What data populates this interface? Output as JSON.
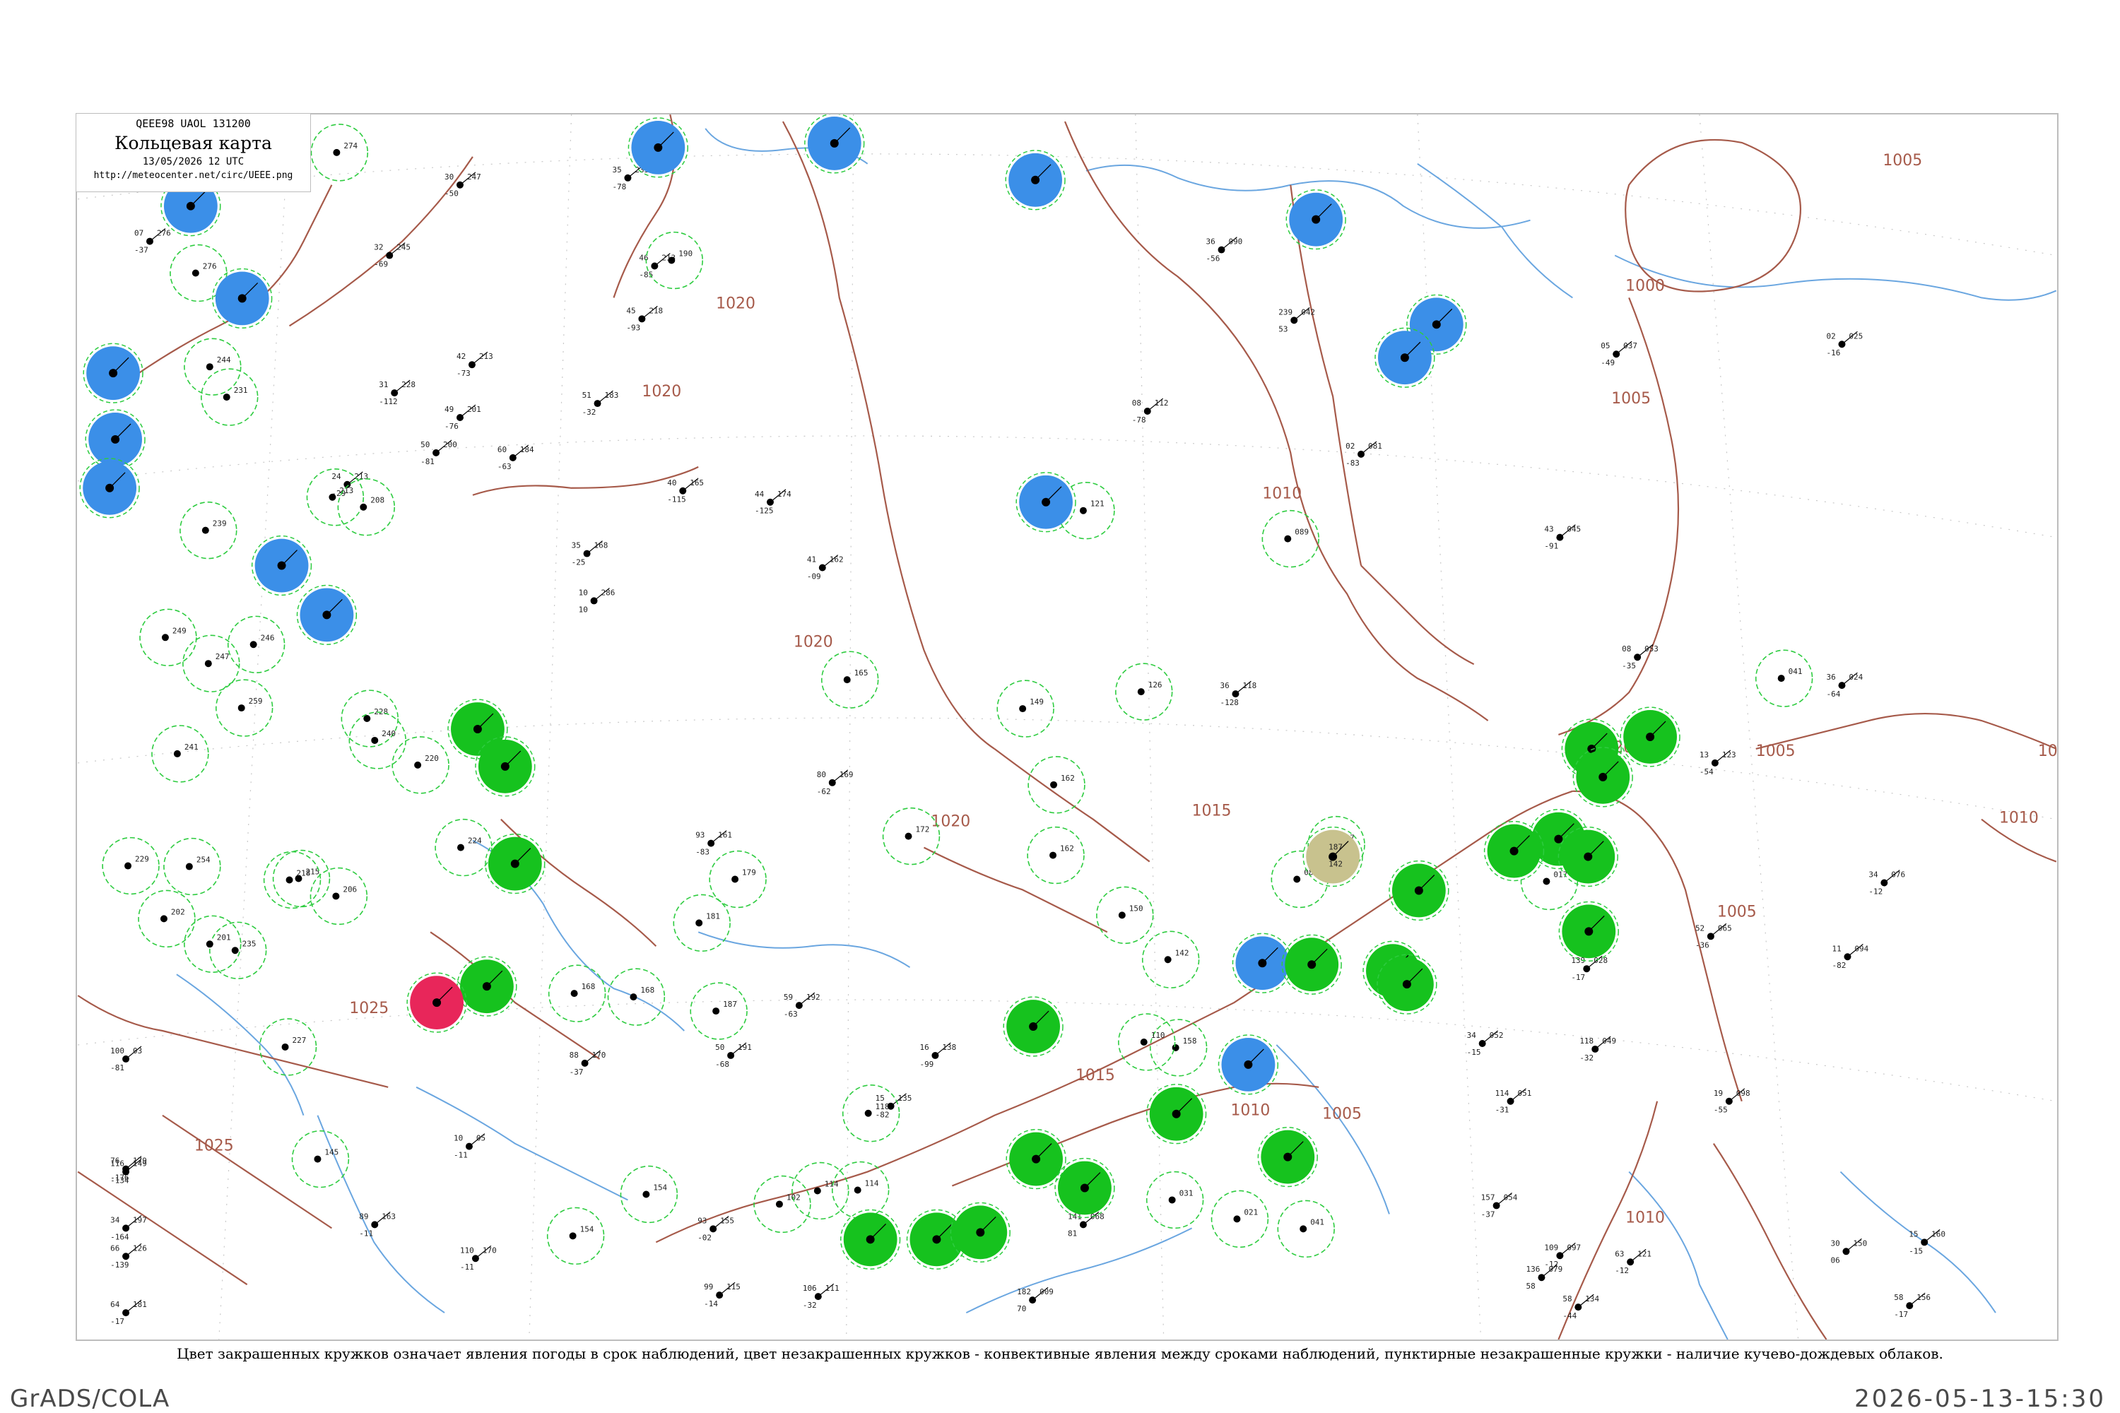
{
  "label_box": {
    "codes": "QEEE98  UAOL  131200",
    "title": "Кольцевая карта",
    "date": "13/05/2026 12 UTC",
    "url": "http://meteocenter.net/circ/UEEE.png"
  },
  "caption": "Цвет закрашенных кружков означает явления погоды в срок наблюдений, цвет незакрашенных кружков - конвективные явления между сроками наблюдений, пунктирные незакрашенные кружки - наличие кучево-дождевых облаков.",
  "footer": {
    "left": "GrADS/COLA",
    "right": "2026-05-13-15:30"
  },
  "colors": {
    "isobar": "#a65a4a",
    "river": "#6aa6e0",
    "rain": "#16c21e",
    "snow": "#3b8fe8",
    "thunder": "#e8265a",
    "fog": "#c8c28e",
    "ring": "#2ecc40"
  },
  "isobars": [
    {
      "label": "1005"
    },
    {
      "label": "1000"
    },
    {
      "label": "1005"
    },
    {
      "label": "1010"
    },
    {
      "label": "1015"
    },
    {
      "label": "1020"
    },
    {
      "label": "1025"
    },
    {
      "label": "1020"
    },
    {
      "label": "1015"
    },
    {
      "label": "1010"
    },
    {
      "label": "1005"
    },
    {
      "label": "1020"
    },
    {
      "label": "1020"
    },
    {
      "label": "1005"
    },
    {
      "label": "1005"
    },
    {
      "label": "1010"
    },
    {
      "label": "1005"
    },
    {
      "label": "1010"
    },
    {
      "label": "1020"
    },
    {
      "label": "1025"
    }
  ],
  "stations": [
    {
      "type": "snow",
      "top": "",
      "bottom": ""
    },
    {
      "type": "snow",
      "top": "",
      "bottom": ""
    },
    {
      "type": "snow",
      "top": "",
      "bottom": ""
    },
    {
      "type": "snow",
      "top": "",
      "bottom": ""
    },
    {
      "type": "snow",
      "top": "",
      "bottom": ""
    },
    {
      "type": "snow",
      "top": "",
      "bottom": ""
    },
    {
      "type": "snow",
      "top": "",
      "bottom": ""
    },
    {
      "type": "snow",
      "top": "",
      "bottom": ""
    },
    {
      "type": "snow",
      "top": "",
      "bottom": ""
    },
    {
      "type": "snow",
      "top": "",
      "bottom": ""
    },
    {
      "type": "snow",
      "top": "",
      "bottom": ""
    },
    {
      "type": "snow",
      "top": "",
      "bottom": ""
    },
    {
      "type": "snow",
      "top": "",
      "bottom": ""
    },
    {
      "type": "snow",
      "top": "",
      "bottom": ""
    },
    {
      "type": "snow",
      "top": "",
      "bottom": ""
    },
    {
      "type": "rain",
      "top": "",
      "bottom": ""
    },
    {
      "type": "rain",
      "top": "",
      "bottom": ""
    },
    {
      "type": "rain",
      "top": "",
      "bottom": ""
    },
    {
      "type": "rain",
      "top": "",
      "bottom": ""
    },
    {
      "type": "rain",
      "top": "",
      "bottom": ""
    },
    {
      "type": "rain",
      "top": "",
      "bottom": ""
    },
    {
      "type": "rain",
      "top": "",
      "bottom": ""
    },
    {
      "type": "rain",
      "top": "",
      "bottom": ""
    },
    {
      "type": "rain",
      "top": "",
      "bottom": ""
    },
    {
      "type": "rain",
      "top": "",
      "bottom": ""
    },
    {
      "type": "rain",
      "top": "",
      "bottom": ""
    },
    {
      "type": "rain",
      "top": "",
      "bottom": ""
    },
    {
      "type": "rain",
      "top": "",
      "bottom": ""
    },
    {
      "type": "rain",
      "top": "",
      "bottom": ""
    },
    {
      "type": "rain",
      "top": "",
      "bottom": ""
    },
    {
      "type": "rain",
      "top": "",
      "bottom": ""
    },
    {
      "type": "rain",
      "top": "",
      "bottom": ""
    },
    {
      "type": "rain",
      "top": "",
      "bottom": ""
    },
    {
      "type": "rain",
      "top": "",
      "bottom": ""
    },
    {
      "type": "rain",
      "top": "",
      "bottom": ""
    },
    {
      "type": "rain",
      "top": "",
      "bottom": ""
    },
    {
      "type": "rain",
      "top": "",
      "bottom": ""
    },
    {
      "type": "rain",
      "top": "",
      "bottom": ""
    },
    {
      "type": "thunder",
      "top": "",
      "bottom": ""
    },
    {
      "type": "fog",
      "top": "187",
      "bottom": "142"
    },
    {
      "type": "snow",
      "top": "",
      "bottom": ""
    }
  ],
  "ring_count_note": "",
  "open_rings": [
    {
      "top": "274"
    },
    {
      "top": "276"
    },
    {
      "top": "244"
    },
    {
      "top": "231"
    },
    {
      "top": "213"
    },
    {
      "top": "208"
    },
    {
      "top": "239"
    },
    {
      "top": "249"
    },
    {
      "top": "247"
    },
    {
      "top": "246"
    },
    {
      "top": "241"
    },
    {
      "top": "259"
    },
    {
      "top": "228"
    },
    {
      "top": "240"
    },
    {
      "top": "220"
    },
    {
      "top": "224"
    },
    {
      "top": "215"
    },
    {
      "top": "206"
    },
    {
      "top": "218"
    },
    {
      "top": "254"
    },
    {
      "top": "229"
    },
    {
      "top": "202"
    },
    {
      "top": "235"
    },
    {
      "top": "201"
    },
    {
      "top": "227"
    },
    {
      "top": "145"
    },
    {
      "top": "168"
    },
    {
      "top": "154"
    },
    {
      "top": "165"
    },
    {
      "top": "181"
    },
    {
      "top": "187"
    },
    {
      "top": "168"
    },
    {
      "top": "172"
    },
    {
      "top": "162"
    },
    {
      "top": "149"
    },
    {
      "top": "126"
    },
    {
      "top": "162"
    },
    {
      "top": "121"
    },
    {
      "top": "150"
    },
    {
      "top": "142"
    },
    {
      "top": "158"
    },
    {
      "top": "110"
    },
    {
      "top": "089"
    },
    {
      "top": "017"
    },
    {
      "top": "041"
    },
    {
      "top": "085"
    },
    {
      "top": "017"
    },
    {
      "top": "154"
    },
    {
      "top": "102"
    },
    {
      "top": "114"
    },
    {
      "top": "118"
    },
    {
      "top": "114"
    },
    {
      "top": "031"
    },
    {
      "top": "021"
    },
    {
      "top": "041"
    },
    {
      "top": "190"
    },
    {
      "top": "179"
    }
  ],
  "plain_stations": [
    {
      "t": "30",
      "p": "247",
      "b": "-50"
    },
    {
      "t": "35",
      "p": "233",
      "b": "-78"
    },
    {
      "t": "07",
      "p": "276",
      "b": "-37"
    },
    {
      "t": "32",
      "p": "245",
      "b": "-69"
    },
    {
      "t": "46",
      "p": "213",
      "b": "-85"
    },
    {
      "t": "45",
      "p": "218",
      "b": "-93"
    },
    {
      "t": "24",
      "p": "213",
      "b": "-29"
    },
    {
      "t": "31",
      "p": "228",
      "b": "-112"
    },
    {
      "t": "42",
      "p": "213",
      "b": "-73"
    },
    {
      "t": "49",
      "p": "201",
      "b": "-76"
    },
    {
      "t": "50",
      "p": "200",
      "b": "-81"
    },
    {
      "t": "60",
      "p": "184",
      "b": "-63"
    },
    {
      "t": "51",
      "p": "183",
      "b": "-32"
    },
    {
      "t": "40",
      "p": "165",
      "b": "-115"
    },
    {
      "t": "44",
      "p": "174",
      "b": "-125"
    },
    {
      "t": "35",
      "p": "168",
      "b": "-25"
    },
    {
      "t": "10",
      "p": "286",
      "b": "10"
    },
    {
      "t": "41",
      "p": "162",
      "b": "-09"
    },
    {
      "t": "36",
      "p": "090",
      "b": "-56"
    },
    {
      "t": "08",
      "p": "112",
      "b": "-78"
    },
    {
      "t": "239",
      "p": "042",
      "b": "53"
    },
    {
      "t": "02",
      "p": "081",
      "b": "-83"
    },
    {
      "t": "43",
      "p": "045",
      "b": "-91"
    },
    {
      "t": "05",
      "p": "037",
      "b": "-49"
    },
    {
      "t": "02",
      "p": "025",
      "b": "-16"
    },
    {
      "t": "36",
      "p": "118",
      "b": "-128"
    },
    {
      "t": "08",
      "p": "053",
      "b": "-35"
    },
    {
      "t": "36",
      "p": "024",
      "b": "-64"
    },
    {
      "t": "13",
      "p": "123",
      "b": "-54"
    },
    {
      "t": "34",
      "p": "076",
      "b": "-12"
    },
    {
      "t": "52",
      "p": "065",
      "b": "-36"
    },
    {
      "t": "11",
      "p": "094",
      "b": "-82"
    },
    {
      "t": "139",
      "p": "028",
      "b": "-17"
    },
    {
      "t": "118",
      "p": "049",
      "b": "-32"
    },
    {
      "t": "19",
      "p": "098",
      "b": "-55"
    },
    {
      "t": "114",
      "p": "051",
      "b": "-31"
    },
    {
      "t": "34",
      "p": "052",
      "b": "-15"
    },
    {
      "t": "157",
      "p": "054",
      "b": "-37"
    },
    {
      "t": "136",
      "p": "079",
      "b": "58"
    },
    {
      "t": "109",
      "p": "097",
      "b": "-12"
    },
    {
      "t": "58",
      "p": "134",
      "b": "-44"
    },
    {
      "t": "63",
      "p": "121",
      "b": "-12"
    },
    {
      "t": "30",
      "p": "150",
      "b": "06"
    },
    {
      "t": "15",
      "p": "160",
      "b": "-15"
    },
    {
      "t": "58",
      "p": "156",
      "b": "-17"
    },
    {
      "t": "182",
      "p": "009",
      "b": "70"
    },
    {
      "t": "141",
      "p": "068",
      "b": "81"
    },
    {
      "t": "106",
      "p": "111",
      "b": "-32"
    },
    {
      "t": "99",
      "p": "115",
      "b": "-14"
    },
    {
      "t": "110",
      "p": "170",
      "b": "-11"
    },
    {
      "t": "89",
      "p": "163",
      "b": "-11"
    },
    {
      "t": "64",
      "p": "181",
      "b": "-17"
    },
    {
      "t": "66",
      "p": "126",
      "b": "-139"
    },
    {
      "t": "34",
      "p": "197",
      "b": "-164"
    },
    {
      "t": "116",
      "p": "149",
      "b": "-134"
    },
    {
      "t": "76",
      "p": "179",
      "b": "-176"
    },
    {
      "t": "100",
      "p": "03",
      "b": "-81"
    },
    {
      "t": "93",
      "p": "161",
      "b": "-83"
    },
    {
      "t": "80",
      "p": "169",
      "b": "-62"
    },
    {
      "t": "88",
      "p": "170",
      "b": "-37"
    },
    {
      "t": "10",
      "p": "05",
      "b": "-11"
    },
    {
      "t": "59",
      "p": "192",
      "b": "-63"
    },
    {
      "t": "50",
      "p": "191",
      "b": "-68"
    },
    {
      "t": "16",
      "p": "138",
      "b": "-99"
    },
    {
      "t": "15",
      "p": "135",
      "b": "-82"
    },
    {
      "t": "93",
      "p": "155",
      "b": "-02"
    }
  ]
}
